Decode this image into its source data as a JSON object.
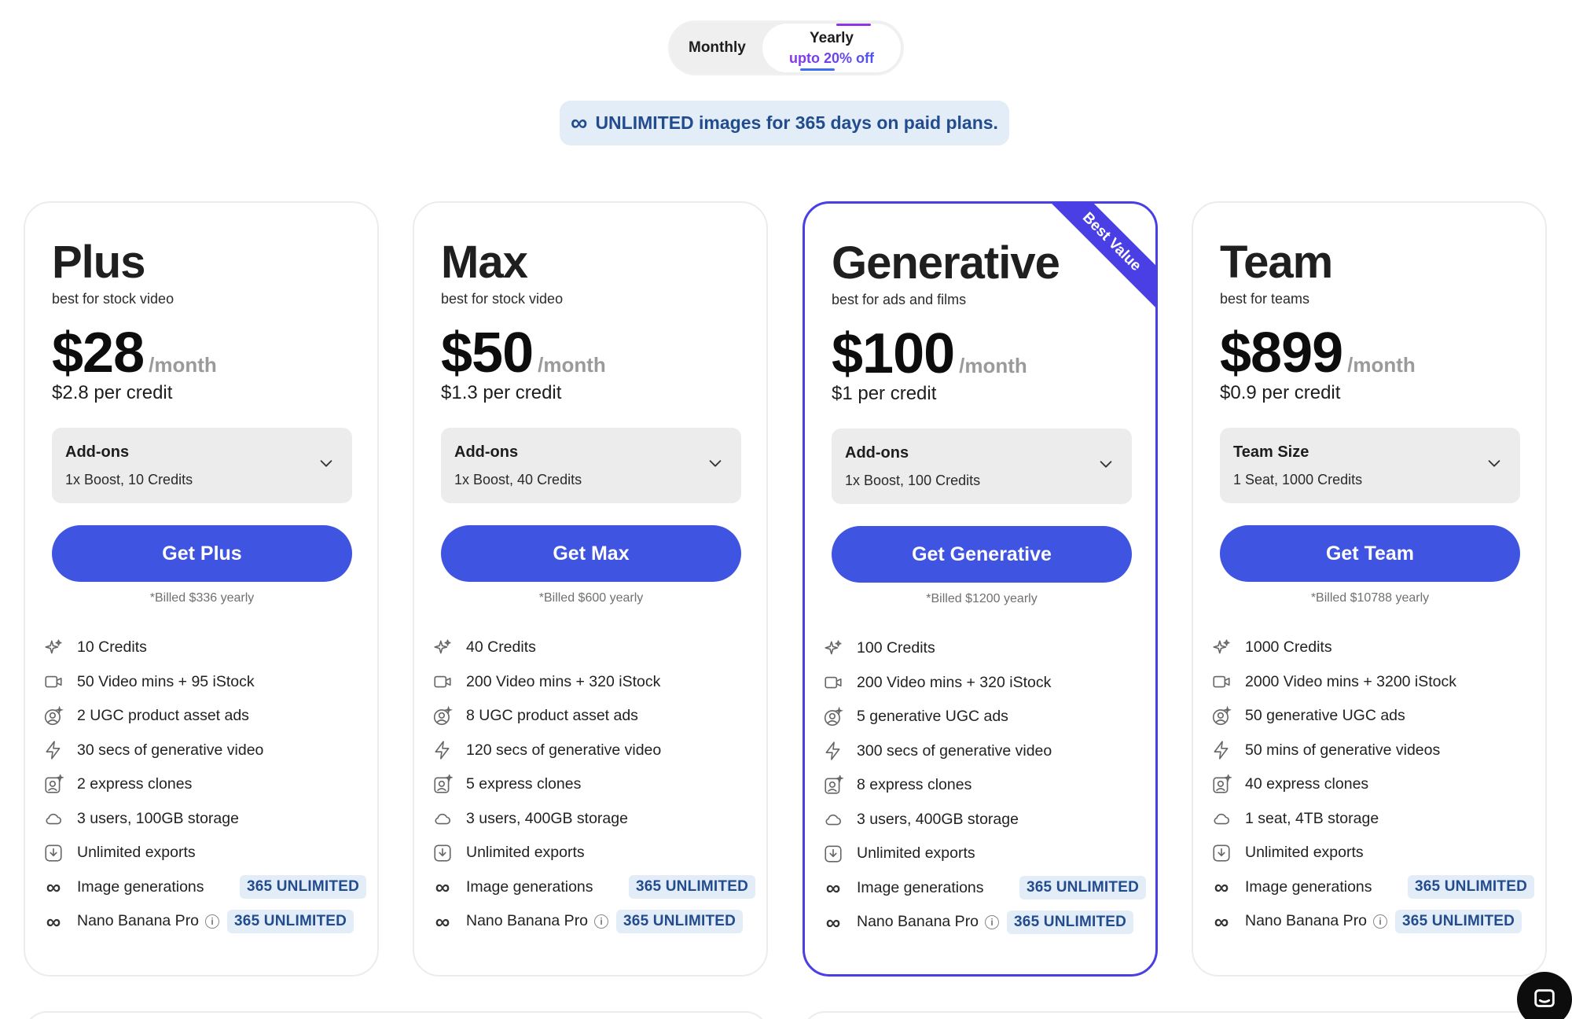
{
  "toggle": {
    "monthly_label": "Monthly",
    "yearly_label": "Yearly",
    "yearly_sub": "upto 20% off",
    "selected": "Yearly"
  },
  "banner": {
    "icon": "infinity-icon",
    "text": "UNLIMITED images for 365 days on paid plans."
  },
  "colors": {
    "accent": "#3f55e2",
    "highlight_border": "#4a3fe4",
    "badge_bg": "#e3edf8",
    "badge_text": "#234c8e"
  },
  "plans": [
    {
      "name": "Plus",
      "tagline": "best for stock video",
      "price": "$28",
      "per": "/month",
      "per_credit": "$2.8 per credit",
      "addon_title": "Add-ons",
      "addon_value": "1x Boost, 10 Credits",
      "cta": "Get Plus",
      "billed": "*Billed $336 yearly",
      "features": [
        {
          "icon": "sparkle-icon",
          "text": "10 Credits"
        },
        {
          "icon": "video-icon",
          "text": "50 Video mins + 95 iStock"
        },
        {
          "icon": "ugc-avatar-icon",
          "text": "2 UGC product asset ads"
        },
        {
          "icon": "lightning-icon",
          "text": "30 secs of generative video"
        },
        {
          "icon": "clone-portrait-icon",
          "text": "2 express clones"
        },
        {
          "icon": "cloud-icon",
          "text": "3 users, 100GB storage"
        },
        {
          "icon": "download-icon",
          "text": "Unlimited exports"
        },
        {
          "icon": "infinity-icon",
          "text": "Image generations",
          "badge": "365 UNLIMITED"
        },
        {
          "icon": "infinity-icon",
          "text": "Nano Banana Pro",
          "info": true,
          "badge": "365 UNLIMITED"
        }
      ]
    },
    {
      "name": "Max",
      "tagline": "best for stock video",
      "price": "$50",
      "per": "/month",
      "per_credit": "$1.3 per credit",
      "addon_title": "Add-ons",
      "addon_value": "1x Boost, 40 Credits",
      "cta": "Get Max",
      "billed": "*Billed $600 yearly",
      "features": [
        {
          "icon": "sparkle-icon",
          "text": "40 Credits"
        },
        {
          "icon": "video-icon",
          "text": "200 Video mins + 320 iStock"
        },
        {
          "icon": "ugc-avatar-icon",
          "text": "8 UGC product asset ads"
        },
        {
          "icon": "lightning-icon",
          "text": "120 secs of generative video"
        },
        {
          "icon": "clone-portrait-icon",
          "text": "5 express clones"
        },
        {
          "icon": "cloud-icon",
          "text": "3 users, 400GB storage"
        },
        {
          "icon": "download-icon",
          "text": "Unlimited exports"
        },
        {
          "icon": "infinity-icon",
          "text": "Image generations",
          "badge": "365 UNLIMITED"
        },
        {
          "icon": "infinity-icon",
          "text": "Nano Banana Pro",
          "info": true,
          "badge": "365 UNLIMITED"
        }
      ]
    },
    {
      "name": "Generative",
      "tagline": "best for ads and films",
      "price": "$100",
      "per": "/month",
      "per_credit": "$1 per credit",
      "addon_title": "Add-ons",
      "addon_value": "1x Boost, 100 Credits",
      "cta": "Get Generative",
      "billed": "*Billed $1200 yearly",
      "ribbon": "Best Value",
      "features": [
        {
          "icon": "sparkle-icon",
          "text": "100 Credits"
        },
        {
          "icon": "video-icon",
          "text": "200 Video mins + 320 iStock"
        },
        {
          "icon": "ugc-avatar-icon",
          "text": "5 generative UGC ads"
        },
        {
          "icon": "lightning-icon",
          "text": "300 secs of generative video"
        },
        {
          "icon": "clone-portrait-icon",
          "text": "8 express clones"
        },
        {
          "icon": "cloud-icon",
          "text": "3 users, 400GB storage"
        },
        {
          "icon": "download-icon",
          "text": "Unlimited exports"
        },
        {
          "icon": "infinity-icon",
          "text": "Image generations",
          "badge": "365 UNLIMITED"
        },
        {
          "icon": "infinity-icon",
          "text": "Nano Banana Pro",
          "info": true,
          "badge": "365 UNLIMITED"
        }
      ]
    },
    {
      "name": "Team",
      "tagline": "best for teams",
      "price": "$899",
      "per": "/month",
      "per_credit": "$0.9 per credit",
      "addon_title": "Team Size",
      "addon_value": "1 Seat, 1000 Credits",
      "cta": "Get Team",
      "billed": "*Billed $10788 yearly",
      "features": [
        {
          "icon": "sparkle-icon",
          "text": "1000 Credits"
        },
        {
          "icon": "video-icon",
          "text": "2000 Video mins + 3200 iStock"
        },
        {
          "icon": "ugc-avatar-icon",
          "text": "50 generative UGC ads"
        },
        {
          "icon": "lightning-icon",
          "text": "50 mins of generative videos"
        },
        {
          "icon": "clone-portrait-icon",
          "text": "40 express clones"
        },
        {
          "icon": "cloud-icon",
          "text": "1 seat, 4TB storage"
        },
        {
          "icon": "download-icon",
          "text": "Unlimited exports"
        },
        {
          "icon": "infinity-icon",
          "text": "Image generations",
          "badge": "365 UNLIMITED"
        },
        {
          "icon": "infinity-icon",
          "text": "Nano Banana Pro",
          "info": true,
          "badge": "365 UNLIMITED"
        }
      ]
    }
  ],
  "chat_widget": {
    "icon": "chat-icon"
  }
}
